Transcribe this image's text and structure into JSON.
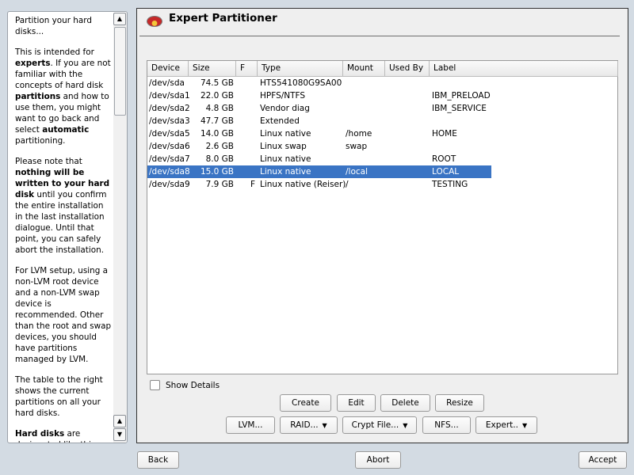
{
  "help": {
    "paragraphs": [
      [
        {
          "t": "Partition your hard disks..."
        }
      ],
      [
        {
          "t": "This is intended for "
        },
        {
          "t": "experts",
          "b": true
        },
        {
          "t": ". If you are not familiar with the concepts of hard disk "
        },
        {
          "t": "partitions",
          "b": true
        },
        {
          "t": " and how to use them, you might want to go back and select "
        },
        {
          "t": "automatic",
          "b": true
        },
        {
          "t": " partitioning."
        }
      ],
      [
        {
          "t": "Please note that "
        },
        {
          "t": "nothing will be written to your hard disk",
          "b": true
        },
        {
          "t": " until you confirm the entire installation in the last installation dialogue. Until that point, you can safely abort the installation."
        }
      ],
      [
        {
          "t": "For LVM setup, using a non-LVM root device and a non-LVM swap device is recommended. Other than the root and swap devices, you should have partitions managed by LVM."
        }
      ],
      [
        {
          "t": "The table to the right shows the current partitions on all your hard disks."
        }
      ],
      [
        {
          "t": "Hard disks",
          "b": true
        },
        {
          "t": " are designated like this"
        }
      ]
    ]
  },
  "title": "Expert Partitioner",
  "table": {
    "columns": [
      "Device",
      "Size",
      "F",
      "Type",
      "Mount",
      "Used By",
      "Label"
    ],
    "rows": [
      [
        "/dev/sda",
        "74.5 GB",
        "",
        "HTS541080G9SA00",
        "",
        "",
        ""
      ],
      [
        "/dev/sda1",
        "22.0 GB",
        "",
        "HPFS/NTFS",
        "",
        "",
        "IBM_PRELOAD"
      ],
      [
        "/dev/sda2",
        "4.8 GB",
        "",
        "Vendor diag",
        "",
        "",
        "IBM_SERVICE"
      ],
      [
        "/dev/sda3",
        "47.7 GB",
        "",
        "Extended",
        "",
        "",
        ""
      ],
      [
        "/dev/sda5",
        "14.0 GB",
        "",
        "Linux native",
        "/home",
        "",
        "HOME"
      ],
      [
        "/dev/sda6",
        "2.6 GB",
        "",
        "Linux swap",
        "swap",
        "",
        ""
      ],
      [
        "/dev/sda7",
        "8.0 GB",
        "",
        "Linux native",
        "",
        "",
        "ROOT"
      ],
      [
        "/dev/sda8",
        "15.0 GB",
        "",
        "Linux native",
        "/local",
        "",
        "LOCAL"
      ],
      [
        "/dev/sda9",
        "7.9 GB",
        "F",
        "Linux native (Reiser)",
        "/",
        "",
        "TESTING"
      ]
    ],
    "selected_index": 7
  },
  "show_details": "Show Details",
  "buttons": {
    "create": "Create",
    "edit": "Edit",
    "delete": "Delete",
    "resize": "Resize",
    "lvm": "LVM...",
    "raid": "RAID...",
    "crypt": "Crypt File...",
    "nfs": "NFS...",
    "expert": "Expert..",
    "back": "Back",
    "abort": "Abort",
    "accept": "Accept"
  },
  "colors": {
    "selection": "#3a74c4"
  }
}
